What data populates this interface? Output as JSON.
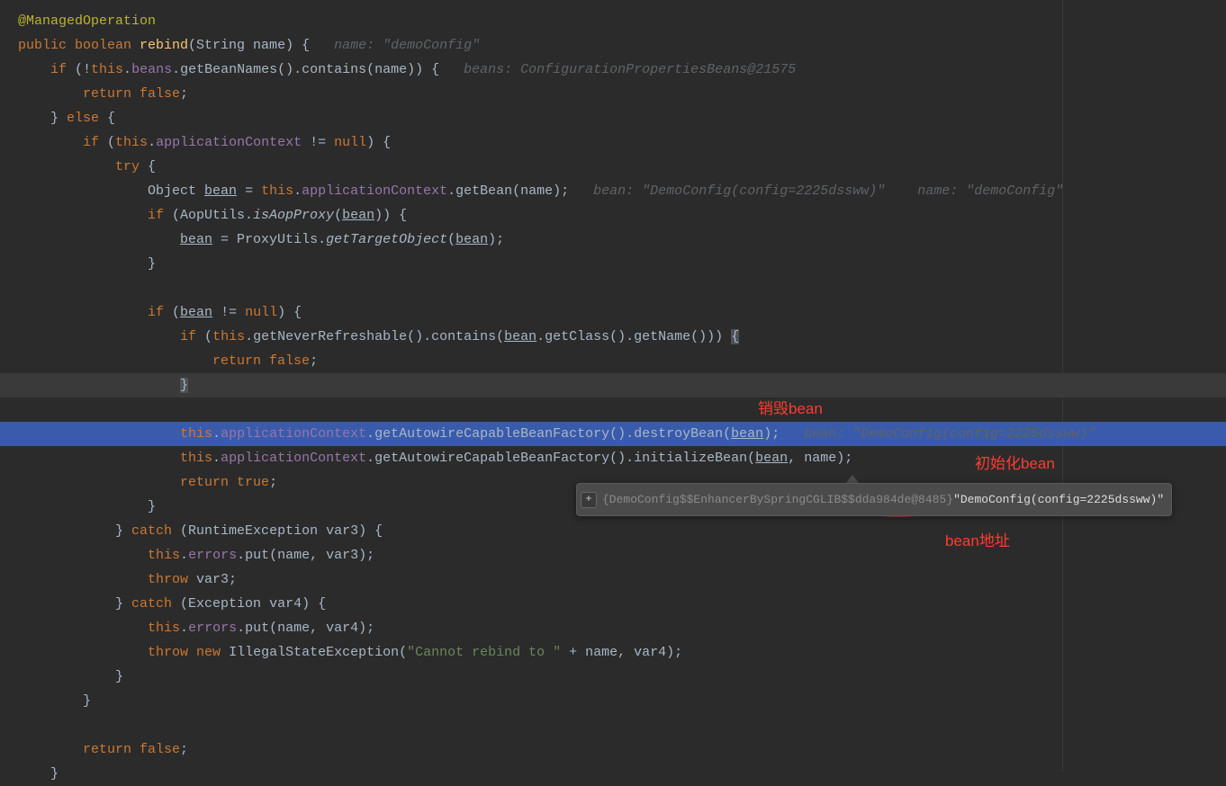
{
  "code": {
    "l1": "@ManagedOperation",
    "l2a": "public ",
    "l2b": "boolean ",
    "l2c": "rebind",
    "l2d": "(String name) {   ",
    "l2hint": "name: \"demoConfig\"",
    "l3a": "    if ",
    "l3b": "(!",
    "l3c": "this",
    "l3d": ".",
    "l3e": "beans",
    "l3f": ".getBeanNames().contains(name)) {   ",
    "l3hint": "beans: ConfigurationPropertiesBeans@21575",
    "l4a": "        return ",
    "l4b": "false",
    "l4c": ";",
    "l5a": "    } ",
    "l5b": "else ",
    "l5c": "{",
    "l6a": "        if ",
    "l6b": "(",
    "l6c": "this",
    "l6d": ".",
    "l6e": "applicationContext ",
    "l6f": "!= ",
    "l6g": "null",
    "l6h": ") {",
    "l7a": "            try ",
    "l7b": "{",
    "l8a": "                Object ",
    "l8b": "bean",
    "l8c": " = ",
    "l8d": "this",
    "l8e": ".",
    "l8f": "applicationContext",
    "l8g": ".getBean(name);   ",
    "l8hint": "bean: \"DemoConfig(config=2225dssww)\"    name: \"demoConfig\"",
    "l9a": "                if ",
    "l9b": "(AopUtils.",
    "l9c": "isAopProxy",
    "l9d": "(",
    "l9e": "bean",
    "l9f": ")) {",
    "l10a": "                    ",
    "l10b": "bean",
    "l10c": " = ProxyUtils.",
    "l10d": "getTargetObject",
    "l10e": "(",
    "l10f": "bean",
    "l10g": ");",
    "l11a": "                }",
    "l12": "",
    "l13a": "                if ",
    "l13b": "(",
    "l13c": "bean",
    "l13d": " != ",
    "l13e": "null",
    "l13f": ") {",
    "l14a": "                    if ",
    "l14b": "(",
    "l14c": "this",
    "l14d": ".getNeverRefreshable().contains(",
    "l14e": "bean",
    "l14f": ".getClass().getName())) ",
    "l14g": "{",
    "l15a": "                        return ",
    "l15b": "false",
    "l15c": ";",
    "l16a": "                    ",
    "l16b": "}",
    "l17": "",
    "l18a": "                    ",
    "l18b": "this",
    "l18c": ".",
    "l18d": "applicationContext",
    "l18e": ".getAutowireCapableBeanFactory().destroyBean(",
    "l18f": "bean",
    "l18g": ");   ",
    "l18hint": "bean: \"DemoConfig(config=2225dssww)\"",
    "l19a": "                    ",
    "l19b": "this",
    "l19c": ".",
    "l19d": "applicationContext",
    "l19e": ".getAutowireCapableBeanFactory().initializeBean(",
    "l19f": "bean",
    "l19g": ", name);",
    "l20a": "                    return ",
    "l20b": "true",
    "l20c": ";",
    "l21a": "                }",
    "l22a": "            } ",
    "l22b": "catch ",
    "l22c": "(RuntimeException var3) {",
    "l23a": "                ",
    "l23b": "this",
    "l23c": ".",
    "l23d": "errors",
    "l23e": ".put(name, var3);",
    "l24a": "                throw ",
    "l24b": "var3;",
    "l25a": "            } ",
    "l25b": "catch ",
    "l25c": "(Exception var4) {",
    "l26a": "                ",
    "l26b": "this",
    "l26c": ".",
    "l26d": "errors",
    "l26e": ".put(name, var4);",
    "l27a": "                throw ",
    "l27b": "new ",
    "l27c": "IllegalStateException(",
    "l27d": "\"Cannot rebind to \"",
    "l27e": " + name, var4);",
    "l28a": "            }",
    "l29a": "        }",
    "l30": "",
    "l31a": "        return ",
    "l31b": "false",
    "l31c": ";",
    "l32a": "    }"
  },
  "annotations": {
    "destroy": "销毁bean",
    "init": "初始化bean",
    "addr": "bean地址"
  },
  "tooltip": {
    "plus": "+",
    "obj": "{DemoConfig$$EnhancerBySpringCGLIB$$dda984de@8485}",
    "val": " \"DemoConfig(config=2225dssww)\""
  }
}
